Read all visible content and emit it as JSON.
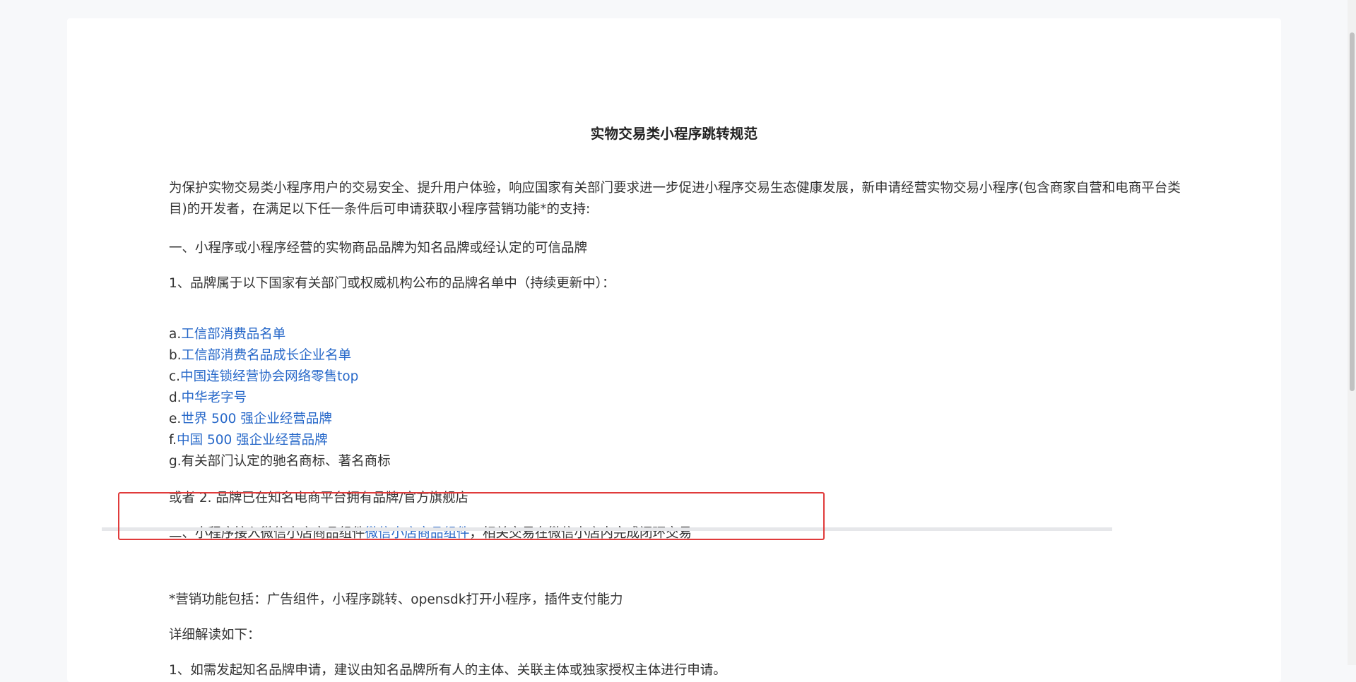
{
  "document": {
    "title": "实物交易类小程序跳转规范",
    "intro": "为保护实物交易类小程序用户的交易安全、提升用户体验，响应国家有关部门要求进一步促进小程序交易生态健康发展，新申请经营实物交易小程序(包含商家自营和电商平台类目)的开发者，在满足以下任一条件后可申请获取小程序营销功能*的支持:",
    "section1_heading": "一、小程序或小程序经营的实物商品品牌为知名品牌或经认定的可信品牌",
    "section1_item1": "1、品牌属于以下国家有关部门或权威机构公布的品牌名单中（持续更新中）：",
    "brand_list": [
      {
        "prefix": "a.",
        "text": "工信部消费品名单",
        "is_link": true
      },
      {
        "prefix": "b.",
        "text": "工信部消费名品成长企业名单",
        "is_link": true
      },
      {
        "prefix": "c.",
        "text": "中国连锁经营协会网络零售top",
        "is_link": true
      },
      {
        "prefix": "d.",
        "text": "中华老字号",
        "is_link": true
      },
      {
        "prefix": "e.",
        "text": "世界 500 强企业经营品牌",
        "is_link": true
      },
      {
        "prefix": "f.",
        "text": "中国 500 强企业经营品牌",
        "is_link": true
      },
      {
        "prefix": "g.",
        "text": "有关部门认定的驰名商标、著名商标",
        "is_link": false
      }
    ],
    "section1_item2": "或者 2. 品牌已在知名电商平台拥有品牌/官方旗舰店",
    "section2_prefix": "二、小程序接入微信小店商品组件",
    "section2_link": "微信小店商品组件",
    "section2_suffix": "，相关交易在微信小店内完成闭环交易",
    "footnote": "*营销功能包括：广告组件，小程序跳转、opensdk打开小程序，插件支付能力",
    "detail_heading": "详细解读如下：",
    "detail_item1": "1、如需发起知名品牌申请，建议由知名品牌所有人的主体、关联主体或独家授权主体进行申请。"
  },
  "colors": {
    "link": "#2768c9",
    "highlight_border": "#e03b3b",
    "text": "#333333",
    "page_bg": "#ffffff",
    "outer_bg": "#f7f8fa"
  }
}
